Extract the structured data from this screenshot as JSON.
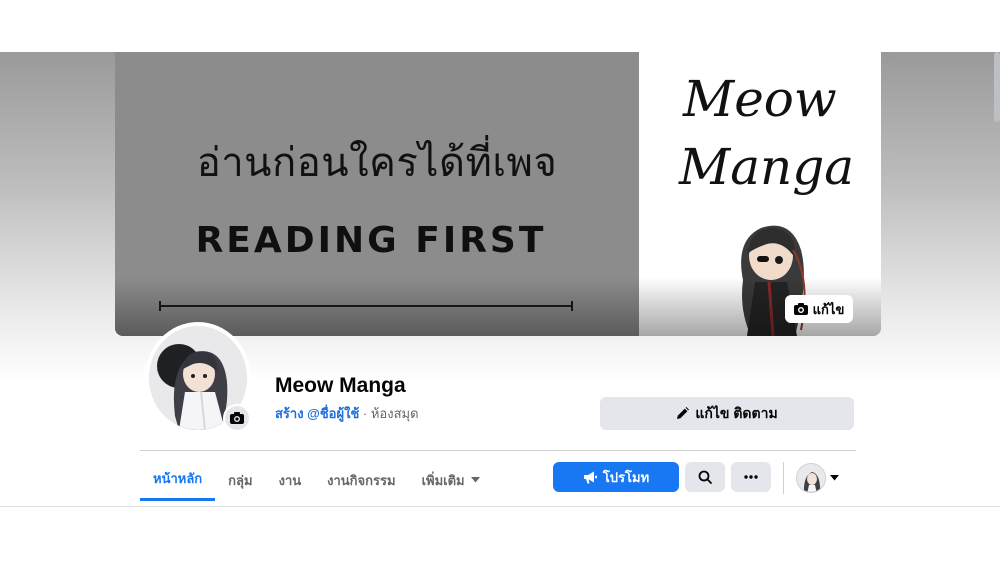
{
  "cover": {
    "thai_text": "อ่านก่อนใครได้ที่เพจ",
    "english_text": "READING FIRST",
    "brand_line1": "Meow",
    "brand_line2": "Manga",
    "edit_label": "แก้ไข"
  },
  "profile": {
    "name": "Meow Manga",
    "create_label": "สร้าง @ชื่อผู้ใช้",
    "separator": " · ",
    "category": "ห้องสมุด",
    "edit_follow_label": "แก้ไข ติดตาม"
  },
  "tabs": [
    {
      "label": "หน้าหลัก",
      "active": true
    },
    {
      "label": "กลุ่ม",
      "active": false
    },
    {
      "label": "งาน",
      "active": false
    },
    {
      "label": "งานกิจกรรม",
      "active": false
    },
    {
      "label": "เพิ่มเติม",
      "active": false
    }
  ],
  "actions": {
    "promote_label": "โปรโมท"
  },
  "colors": {
    "accent": "#1877f2",
    "link": "#216fdb",
    "secondary_button": "#e4e6eb"
  },
  "icons": [
    "camera-icon",
    "pencil-icon",
    "megaphone-icon",
    "search-icon",
    "more-icon",
    "caret-down-icon"
  ]
}
